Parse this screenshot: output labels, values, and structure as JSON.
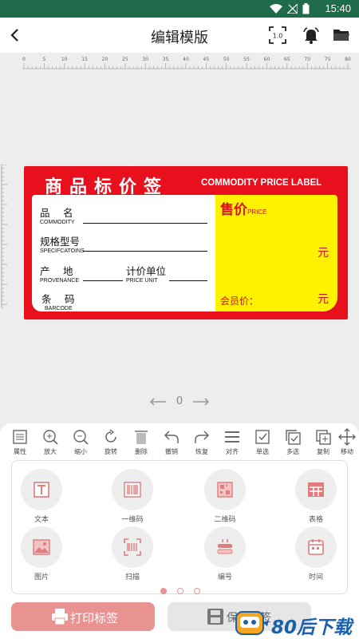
{
  "status": {
    "time": "15:40"
  },
  "header": {
    "title": "编辑模版",
    "scale_badge": "1.0"
  },
  "ruler": {
    "top_ticks": [
      "0",
      "5",
      "10",
      "15",
      "20",
      "25",
      "30",
      "35",
      "40",
      "45",
      "50",
      "55",
      "60",
      "65",
      "70",
      "75",
      "80"
    ]
  },
  "label": {
    "title": "商品标价签",
    "subtitle": "COMMODITY PRICE LABEL",
    "commodity_cn": "品　名",
    "commodity_en": "COMMODITY",
    "spec_cn": "规格型号",
    "spec_en": "SPECIFCATOINS",
    "prov_cn": "产　地",
    "prov_en": "PROVENANCE",
    "unit_cn": "计价单位",
    "unit_en": "PRICE UNIT",
    "barcode_cn": "条　码",
    "barcode_en": "BARCODE",
    "price_cn": "售价",
    "price_en": "PRICE",
    "yuan1": "元",
    "member_price": "会员价：",
    "yuan2": "元",
    "colors": {
      "red": "#e8101c",
      "yellow": "#fff200"
    }
  },
  "pager": {
    "page": "0"
  },
  "toolbar": {
    "tools": [
      {
        "label": "属性",
        "icon": "properties-icon"
      },
      {
        "label": "放大",
        "icon": "zoom-in-icon"
      },
      {
        "label": "缩小",
        "icon": "zoom-out-icon"
      },
      {
        "label": "旋转",
        "icon": "rotate-icon"
      },
      {
        "label": "删除",
        "icon": "delete-icon"
      },
      {
        "label": "撤销",
        "icon": "undo-icon"
      },
      {
        "label": "恢复",
        "icon": "redo-icon"
      },
      {
        "label": "对齐",
        "icon": "align-icon"
      },
      {
        "label": "单选",
        "icon": "single-select-icon"
      },
      {
        "label": "多选",
        "icon": "multi-select-icon"
      },
      {
        "label": "复制",
        "icon": "copy-icon"
      },
      {
        "label": "移动",
        "icon": "move-icon"
      }
    ]
  },
  "panel": {
    "items": [
      {
        "label": "文本",
        "icon": "text-icon"
      },
      {
        "label": "一维码",
        "icon": "barcode-icon"
      },
      {
        "label": "二维码",
        "icon": "qrcode-icon"
      },
      {
        "label": "表格",
        "icon": "table-icon"
      },
      {
        "label": "图片",
        "icon": "image-icon"
      },
      {
        "label": "扫描",
        "icon": "scan-icon"
      },
      {
        "label": "编号",
        "icon": "serial-number-icon"
      },
      {
        "label": "时间",
        "icon": "time-icon"
      }
    ]
  },
  "buttons": {
    "print": "打印标签",
    "save": "保存标签"
  },
  "watermark": {
    "text": "80后下载"
  }
}
